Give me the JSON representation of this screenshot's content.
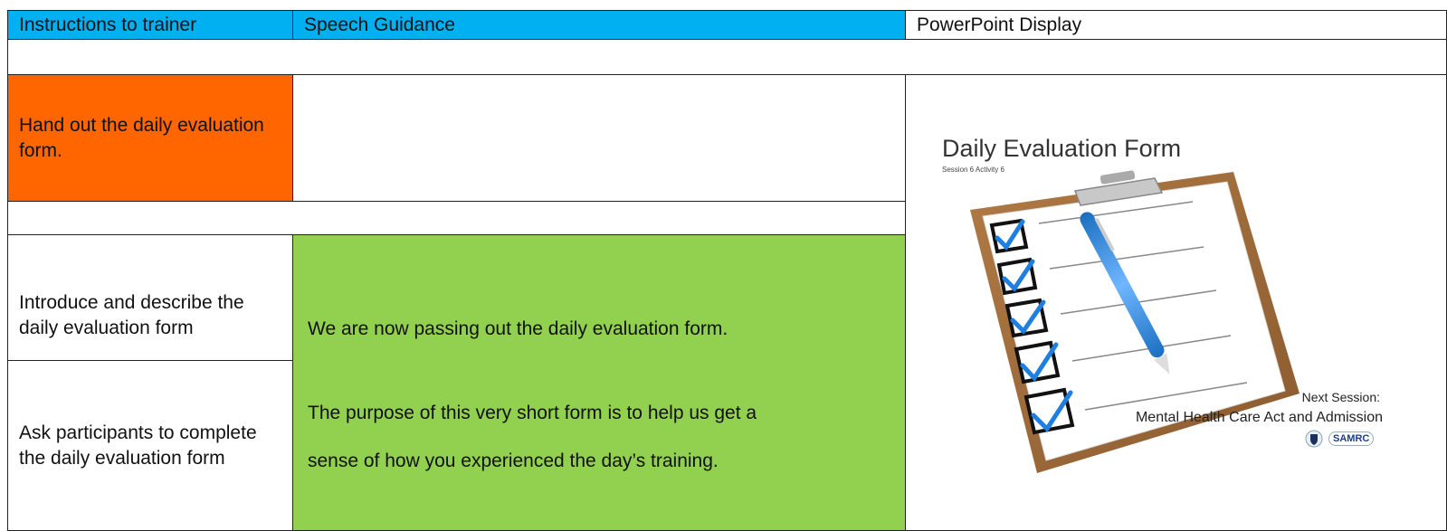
{
  "header": {
    "col1": "Instructions to trainer",
    "col2": "Speech Guidance",
    "col3": "PowerPoint Display"
  },
  "rows": {
    "handout": "Hand out the daily evaluation form.",
    "introduce": "Introduce and describe the daily evaluation form",
    "ask": "Ask participants to complete the daily evaluation form"
  },
  "speech": {
    "line1": "We are now passing out the daily evaluation form.",
    "line2a": "The purpose of this very short form is to help us get a",
    "line2b": "sense of how you experienced the day’s training."
  },
  "slide": {
    "title": "Daily Evaluation Form",
    "subtitle": "Session 6 Activity 6",
    "next_label": "Next Session:",
    "next_title": "Mental Health Care Act and Admission",
    "logo_text": "SAMRC"
  },
  "colors": {
    "header_blue": "#00b0f0",
    "instruction_orange": "#ff6600",
    "speech_green": "#92d050"
  }
}
